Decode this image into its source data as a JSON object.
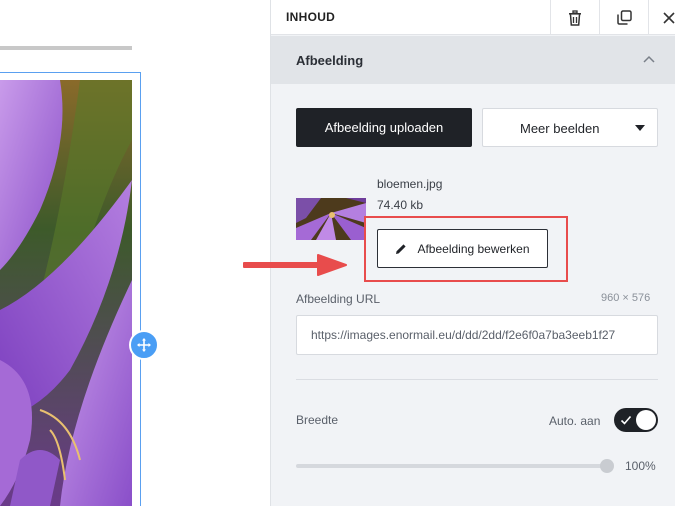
{
  "panel": {
    "title": "INHOUD",
    "header_icons": [
      "trash-icon",
      "duplicate-icon",
      "close-icon"
    ]
  },
  "section": {
    "title": "Afbeelding",
    "collapse_icon": "chevron-up-icon"
  },
  "buttons": {
    "upload_label": "Afbeelding uploaden",
    "more_images_label": "Meer beelden",
    "edit_label": "Afbeelding bewerken"
  },
  "file": {
    "name": "bloemen.jpg",
    "size": "74.40 kb"
  },
  "url_field": {
    "label": "Afbeelding URL",
    "dimensions": "960 × 576",
    "value": "https://images.enormail.eu/d/dd/2dd/f2e6f0a7ba3eeb1f27"
  },
  "width_setting": {
    "label": "Breedte",
    "auto_label": "Auto. aan",
    "auto_enabled": true,
    "value_label": "100%",
    "value_fraction": 1.0
  },
  "colors": {
    "accent_dark": "#1f2227",
    "selection_blue": "#4a9ef5",
    "annotation_red": "#e84c4c"
  }
}
